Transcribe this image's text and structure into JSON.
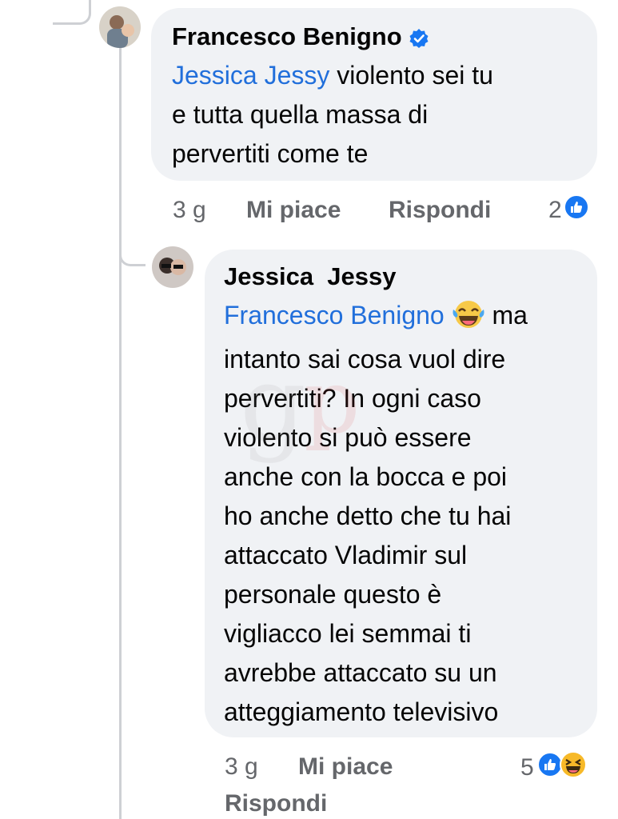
{
  "comments": [
    {
      "author": "Francesco Benigno",
      "verified": true,
      "mention": "Jessica  Jessy",
      "text_lines": [
        " violento sei tu",
        "e tutta quella massa di",
        "pervertiti come te"
      ],
      "time": "3 g",
      "like_label": "Mi piace",
      "reply_label": "Rispondi",
      "reaction_count": "2",
      "reactions": [
        "like-icon"
      ]
    },
    {
      "author": "Jessica  Jessy",
      "verified": false,
      "mention": "Francesco Benigno",
      "emoji": "laughing-tears-emoji",
      "text_lines": [
        " ma",
        "intanto sai cosa vuol dire",
        "pervertiti? In ogni caso",
        "violento si può essere",
        "anche con la bocca e poi",
        "ho anche detto che tu hai",
        "attaccato Vladimir sul",
        "personale questo è",
        "vigliacco lei semmai ti",
        "avrebbe attaccato su un",
        "atteggiamento televisivo"
      ],
      "time": "3 g",
      "like_label": "Mi piace",
      "reply_label": "Rispondi",
      "reaction_count": "5",
      "reactions": [
        "like-icon",
        "haha-icon"
      ]
    }
  ],
  "colors": {
    "bubble": "#f0f2f5",
    "mention": "#216fdb",
    "meta": "#65676b",
    "like": "#1877f2",
    "haha": "#f7b928"
  }
}
